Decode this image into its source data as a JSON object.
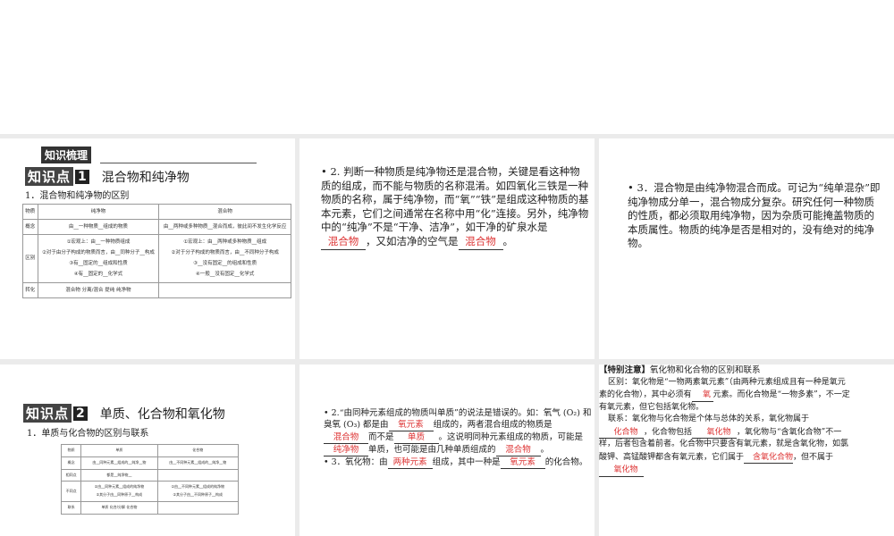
{
  "slide1": {
    "badge": "知识梳理",
    "kp": "知识点",
    "num": "1",
    "title": "混合物和纯净物",
    "sub": "1．混合物和纯净物的区别",
    "table": {
      "headers": [
        "物质",
        "纯净物",
        "混合物"
      ],
      "rows": [
        {
          "label": "概念",
          "a": [
            "由__一种物质__组成的物质"
          ],
          "b": [
            "由__两种或多种物质__混合而成，彼此间不发生化学反应"
          ]
        },
        {
          "label": "区别",
          "a": [
            "①宏观上：由__一种物质组成",
            "②对于由分子构成的物质而言，由__同种分子__构成",
            "③有__固定的__组成和性质",
            "④有__固定的__化学式"
          ],
          "b": [
            "①宏观上：由__两种或多种物质__组成",
            "②对于分子构成的物质而言，由__不同种分子构成",
            "③__没有固定__的组成和性质",
            "④一般__没有固定__化学式"
          ]
        },
        {
          "label": "转化",
          "a": [
            "混合物 分离/混合 提纯 纯净物"
          ],
          "b": [
            ""
          ]
        }
      ]
    }
  },
  "slide2": {
    "text": "2. 判断一种物质是纯净物还是混合物，关键是看这种物质的组成，而不能与物质的名称混淆。如四氧化三铁是一种物质的名称，属于纯净物，而“氧”“铁”是组成这种物质的基本元素，它们之间通常在名称中用“化”连接。另外，纯净物中的“纯净”不是“干净、洁净”，如干净的矿泉水是",
    "mid": "，又如洁净的空气是",
    "end": "。",
    "ans1": "混合物",
    "ans2": "混合物"
  },
  "slide3": {
    "text": "3．混合物是由纯净物混合而成。可记为“纯单混杂”即纯净物成分单一，混合物成分复杂。研究任何一种物质的性质，都必须取用纯净物，因为杂质可能掩盖物质的本质属性。物质的纯净是否是相对的，没有绝对的纯净物。"
  },
  "slide4": {
    "kp": "知识点",
    "num": "2",
    "title": "单质、化合物和氧化物",
    "sub": "1．单质与化合物的区别与联系",
    "table": {
      "headers": [
        "物质",
        "单质",
        "化合物"
      ],
      "rows": [
        {
          "label": "概念",
          "a": [
            "由__同种元素__组成的__纯净__物"
          ],
          "b": [
            "由__不同种元素__组成的__纯净__物"
          ]
        },
        {
          "label": "相同点",
          "a": [
            "都是__纯净物__"
          ],
          "b": [
            ""
          ]
        },
        {
          "label": "不同点",
          "a": [
            "①由__同种元素__组成的纯净物",
            "②其分子由__同种原子__构成"
          ],
          "b": [
            "①由__不同种元素__组成的纯净物",
            "②其分子由__不同种原子__构成"
          ]
        },
        {
          "label": "联系",
          "a": [
            "单质 化合/分解 化合物"
          ],
          "b": [
            ""
          ]
        }
      ]
    }
  },
  "slide5": {
    "p1a": "2.“由同种元素组成的物质叫单质”的说法是错误的。如：氧气 (O₂) 和臭氧 (O₃) 都是由",
    "p1b": "组成的，两者混合组成的物质是",
    "p1c": "而不是",
    "p1d": "。这说明同种元素组成的物质，可能是",
    "p1e": "单质，也可能是由几种单质组成的",
    "p1f": "。",
    "ans": [
      "氧元素",
      "混合物",
      "单质",
      "纯净物",
      "混合物"
    ],
    "p2a": "3．氧化物：由",
    "p2b": "组成，其中一种是",
    "p2c": "的化合物。",
    "ans2": [
      "两种元素",
      "氧元素"
    ]
  },
  "slide6": {
    "head": "【特别注意】",
    "headText": "氧化物和化合物的区别和联系",
    "p1a": "区别：氧化物是“一物两素氧元素”（由两种元素组成且有一种是氧元素的化合物），其中必须有",
    "p1ans": "氧",
    "p1b": "元素。而化合物是“一物多素”，不一定有氧元素，但它包括氧化物。",
    "p2a": "联系：氧化物与化合物是个体与总体的关系，氧化物属于",
    "ans1": "化合物",
    "p2b": "，化合物包括",
    "ans2": "氧化物",
    "p2c": "，氧化物与“含氧化合物”不一样，后者包含着前者。化合物中只要含有氧元素，就是含氧化物，如氯酸钾、高锰酸钾都含有氧元素，它们属于",
    "ans3": "含氧化合物",
    "p2d": "，但不属于",
    "ans4": "氧化物"
  }
}
